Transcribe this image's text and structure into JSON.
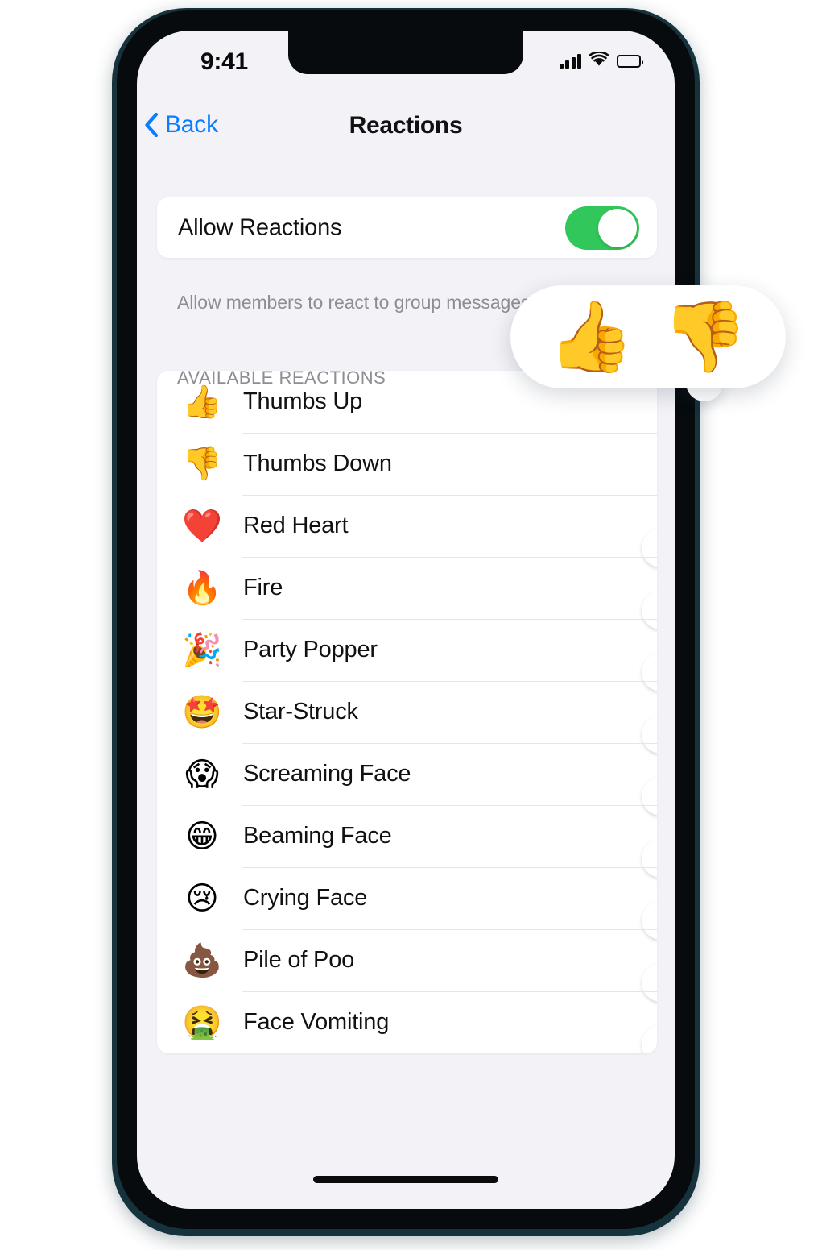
{
  "status_bar": {
    "time": "9:41",
    "cellular_icon": "cellular-bars-icon",
    "wifi_icon": "wifi-icon",
    "battery_icon": "battery-full-icon"
  },
  "nav": {
    "back_label": "Back",
    "back_icon": "chevron-left-icon",
    "title": "Reactions"
  },
  "allow_section": {
    "label": "Allow Reactions",
    "enabled": true,
    "footer": "Allow members to react to group messages"
  },
  "available_section": {
    "header": "AVAILABLE REACTIONS",
    "rows": [
      {
        "emoji": "👍",
        "icon_name": "thumbs-up-emoji",
        "label": "Thumbs Up",
        "enabled": true
      },
      {
        "emoji": "👎",
        "icon_name": "thumbs-down-emoji",
        "label": "Thumbs Down",
        "enabled": true
      },
      {
        "emoji": "❤️",
        "icon_name": "red-heart-emoji",
        "label": "Red Heart",
        "enabled": false
      },
      {
        "emoji": "🔥",
        "icon_name": "fire-emoji",
        "label": "Fire",
        "enabled": false
      },
      {
        "emoji": "🎉",
        "icon_name": "party-popper-emoji",
        "label": "Party Popper",
        "enabled": false
      },
      {
        "emoji": "🤩",
        "icon_name": "star-struck-emoji",
        "label": "Star-Struck",
        "enabled": false
      },
      {
        "emoji": "😱",
        "icon_name": "screaming-face-emoji",
        "label": "Screaming Face",
        "enabled": false
      },
      {
        "emoji": "😁",
        "icon_name": "beaming-face-emoji",
        "label": "Beaming Face",
        "enabled": false
      },
      {
        "emoji": "😢",
        "icon_name": "crying-face-emoji",
        "label": "Crying Face",
        "enabled": false
      },
      {
        "emoji": "💩",
        "icon_name": "pile-of-poo-emoji",
        "label": "Pile of Poo",
        "enabled": false
      },
      {
        "emoji": "🤮",
        "icon_name": "face-vomiting-emoji",
        "label": "Face Vomiting",
        "enabled": false
      }
    ]
  },
  "reaction_overlay": {
    "emojis": [
      "👍",
      "👎"
    ],
    "icon_names": [
      "thumbs-up-emoji",
      "thumbs-down-emoji"
    ]
  },
  "colors": {
    "accent_blue": "#0a7cff",
    "toggle_on_green": "#32c75a",
    "toggle_off_gray": "#e6e6ea",
    "screen_background": "#f2f2f7",
    "card_background": "#ffffff",
    "secondary_text": "#8d8d93",
    "device_bezel": "#16323d"
  },
  "home_indicator": "home-indicator-bar"
}
